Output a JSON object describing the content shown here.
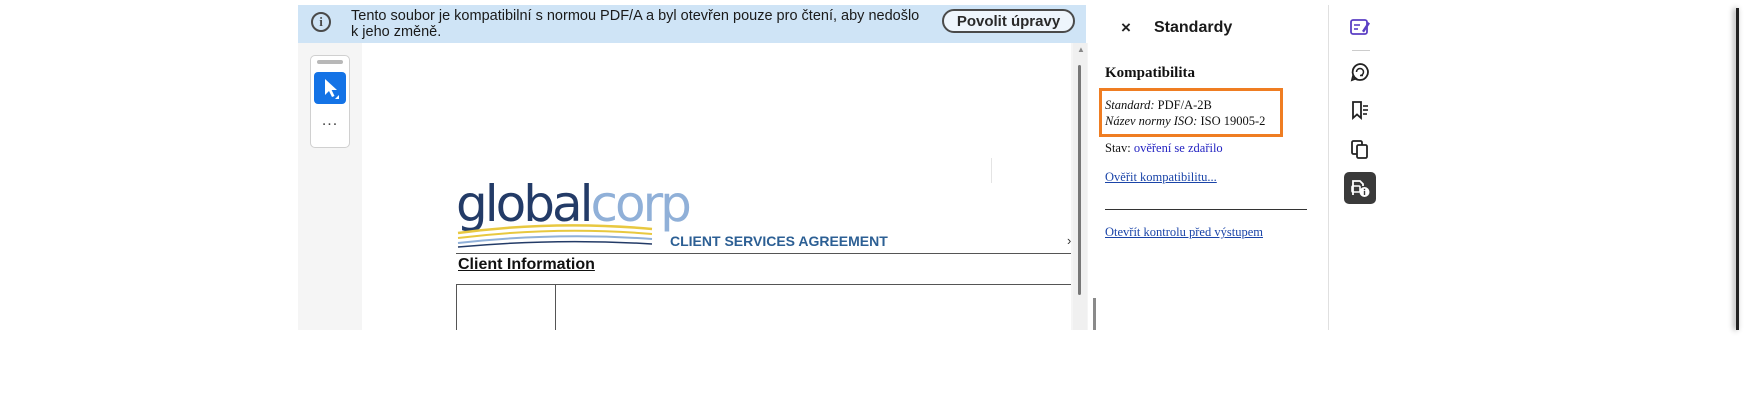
{
  "banner": {
    "message": "Tento soubor je kompatibilní s normou PDF/A a byl otevřen pouze pro čtení, aby nedošlo k jeho změně.",
    "button_label": "Povolit úpravy"
  },
  "toolbar": {
    "more_label": "..."
  },
  "document": {
    "logo_part1": "global",
    "logo_part2": "corp",
    "agreement_title": "CLIENT SERVICES AGREEMENT",
    "section_heading": "Client Information",
    "clip_mark": "›"
  },
  "panel": {
    "close_label": "×",
    "title": "Standardy",
    "section_heading": "Kompatibilita",
    "standard_label": "Standard:",
    "standard_value": "PDF/A-2B",
    "iso_label": "Název normy ISO:",
    "iso_value": "ISO 19005-2",
    "status_label": "Stav:",
    "status_value": "ověření se zdařilo",
    "verify_link": "Ověřit kompatibilitu...",
    "preflight_link": "Otevřít kontrolu před výstupem"
  },
  "rail": {
    "icons": [
      "edit-pdf-icon",
      "comment-icon",
      "bookmarks-icon",
      "copy-pages-icon",
      "standards-icon"
    ],
    "active": "standards-icon"
  },
  "colors": {
    "banner_bg": "#cfe4f6",
    "accent_blue": "#1473e6",
    "highlight_orange": "#ef7d22",
    "link_blue": "#1a44a8",
    "rail_icon_purple": "#5b3fc4"
  }
}
